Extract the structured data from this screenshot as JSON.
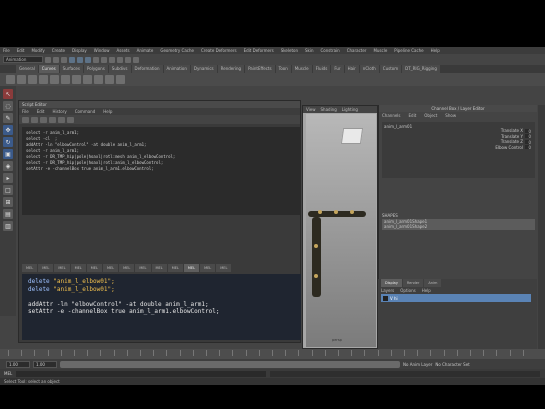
{
  "menubar": [
    "File",
    "Edit",
    "Modify",
    "Create",
    "Display",
    "Window",
    "Assets",
    "Animate",
    "Geometry Cache",
    "Create Deformers",
    "Edit Deformers",
    "Skeleton",
    "Skin",
    "Constrain",
    "Character",
    "Muscle",
    "Pipeline Cache",
    "Help"
  ],
  "statusline": {
    "mode": "Animation"
  },
  "shelf_tabs": [
    "General",
    "Curves",
    "Surfaces",
    "Polygons",
    "Subdivs",
    "Deformation",
    "Animation",
    "Dynamics",
    "Rendering",
    "PaintEffects",
    "Toon",
    "Muscle",
    "Fluids",
    "Fur",
    "Hair",
    "nCloth",
    "Custom",
    "DT_RIG_Rigging"
  ],
  "active_shelf_tab": "Curves",
  "script_editor": {
    "title": "Script Editor",
    "menu": [
      "File",
      "Edit",
      "History",
      "Command",
      "Help"
    ],
    "history": [
      "select -r anim_l_arm1;",
      "select -cl  ;",
      "addAttr -ln \"elbowControl\" -at double anim_l_arm1;",
      "select -r anim_l_arm1;",
      "select -r DR_TMP_hip|pole|hoaxl|rotl:mesh anim_l_elbowControl;",
      "select -r DR_TMP_hip|pole|hoaxl|rotl:anim_l_elbowControl;",
      "setAttr -e -channelBox true anim_l_arm1.elbowControl;"
    ],
    "tabs": [
      "MEL",
      "MEL",
      "MEL",
      "MEL",
      "MEL",
      "MEL",
      "MEL",
      "MEL",
      "MEL",
      "MEL",
      "MEL",
      "MEL",
      "MEL"
    ],
    "input_lines": [
      {
        "kw": "delete",
        "str": "\"anim_l_elbow01\";",
        "rest": ""
      },
      {
        "kw": "delete",
        "str": "\"anim_l_elbow01\";",
        "rest": ""
      },
      {
        "kw": "",
        "str": "",
        "rest": ""
      },
      {
        "kw": "",
        "str": "",
        "rest": "addAttr -ln \"elbowControl\" -at double anim_l_arm1;"
      },
      {
        "kw": "",
        "str": "",
        "rest": "setAttr -e -channelBox true anim_l_arm1.elbowControl;"
      }
    ]
  },
  "viewport": {
    "menu": [
      "View",
      "Shading",
      "Lighting"
    ],
    "camera_label": "persp"
  },
  "channel_box": {
    "title": "Channel Box / Layer Editor",
    "menu": [
      "Channels",
      "Edit",
      "Object",
      "Show"
    ],
    "node": "anim_l_arm01",
    "attrs": [
      {
        "name": "Translate X",
        "value": "0"
      },
      {
        "name": "Translate Y",
        "value": "0"
      },
      {
        "name": "Translate Z",
        "value": "0"
      },
      {
        "name": "Elbow Control",
        "value": "0"
      }
    ],
    "shapes": [
      "SHAPES",
      "anim_l_arm01Shape1",
      "anim_l_arm01Shape2"
    ]
  },
  "layer_editor": {
    "tabs": [
      "Display",
      "Render",
      "Anim"
    ],
    "active_tab": "Display",
    "menu": [
      "Layers",
      "Options",
      "Help"
    ],
    "layer_name": "V  hi"
  },
  "range": {
    "start": "1.00",
    "end": "1.00",
    "anim_layer": "No Anim Layer",
    "char_set": "No Character Set"
  },
  "cmdline": {
    "lang": "MEL"
  },
  "help_line": "Select Tool: select an object"
}
